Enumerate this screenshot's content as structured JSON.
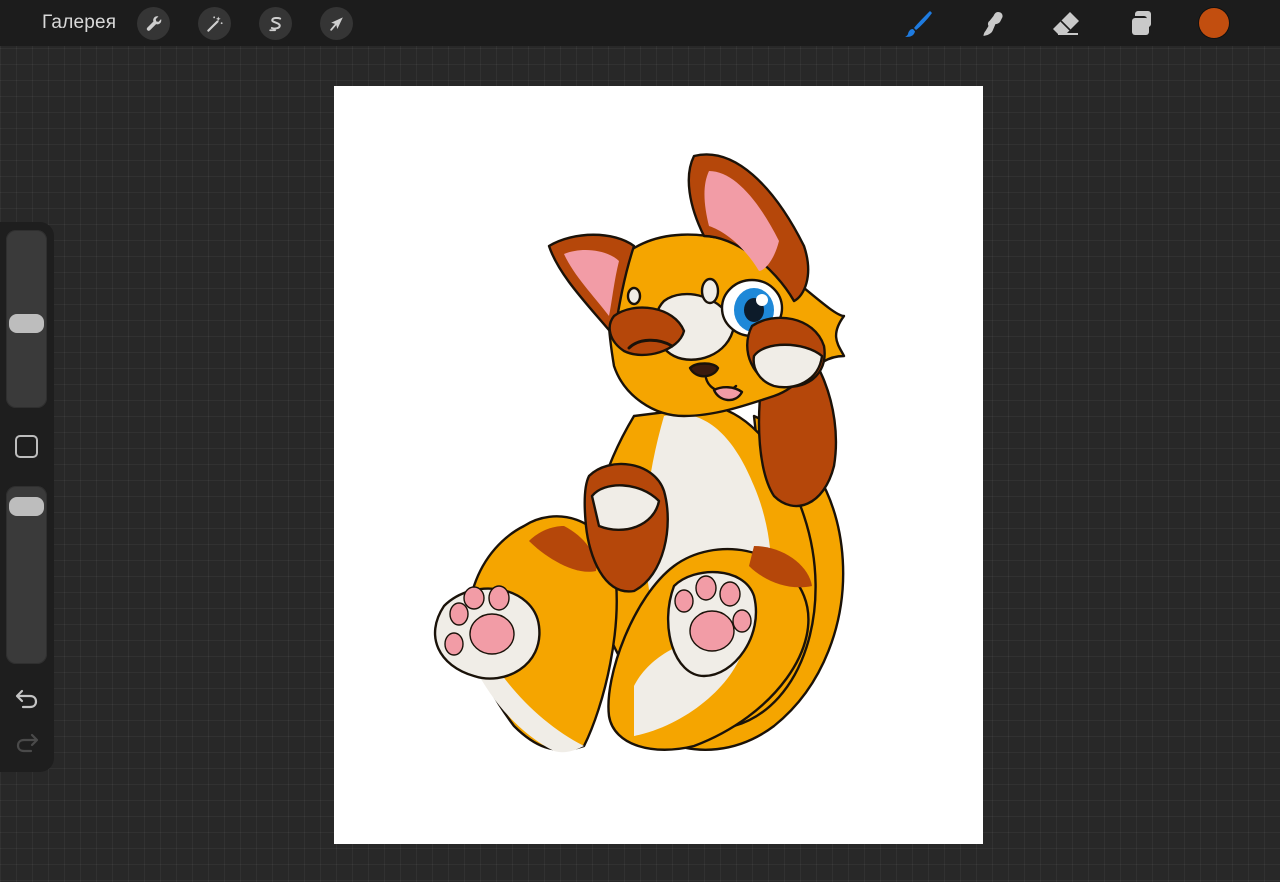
{
  "topbar": {
    "gallery_label": "Галерея",
    "left_tools": [
      {
        "name": "actions",
        "icon": "wrench-icon"
      },
      {
        "name": "adjustments",
        "icon": "magic-wand-icon"
      },
      {
        "name": "selection",
        "icon": "selection-s-icon"
      },
      {
        "name": "transform",
        "icon": "arrow-cursor-icon"
      }
    ],
    "right_tools": [
      {
        "name": "brush",
        "icon": "brush-icon",
        "active": true
      },
      {
        "name": "smudge",
        "icon": "smudge-icon",
        "active": false
      },
      {
        "name": "eraser",
        "icon": "eraser-icon",
        "active": false
      },
      {
        "name": "layers",
        "icon": "layers-icon",
        "active": false
      }
    ],
    "current_color": "#c24e0f"
  },
  "sidebar": {
    "brush_size_level": 0.47,
    "opacity_level": 0.95,
    "modify_button_icon": "square-outline-icon",
    "undo_icon": "undo-arrow-icon",
    "redo_icon": "redo-arrow-icon"
  },
  "canvas": {
    "background": "#ffffff",
    "artwork": "fox-character-illustration"
  },
  "colors": {
    "accent": "#1e7be0",
    "fox_orange": "#f5a500",
    "fox_brown": "#b5470a",
    "fox_cream": "#f0ede7",
    "paw_pink": "#f29ca6"
  }
}
